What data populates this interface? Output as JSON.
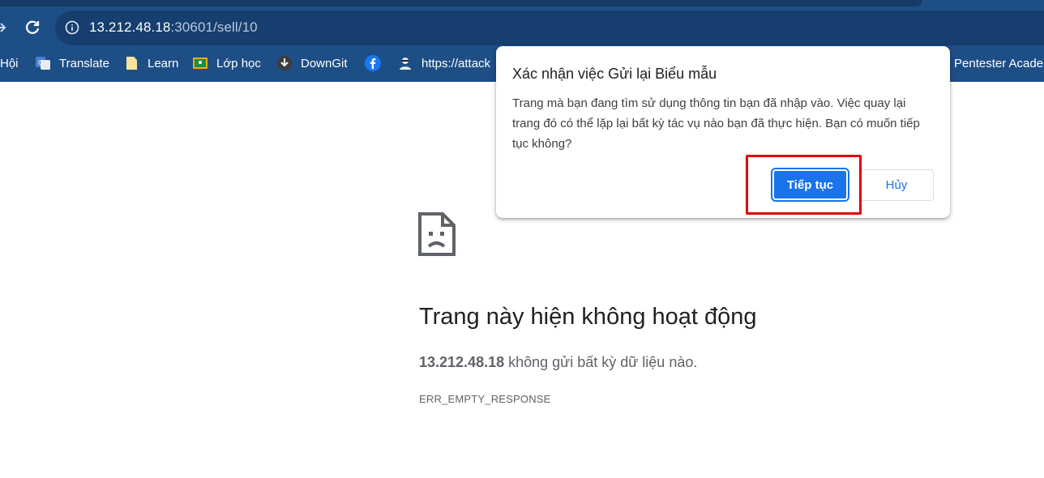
{
  "browser": {
    "url_host": "13.212.48.18",
    "url_path": ":30601/sell/10",
    "bookmarks": [
      {
        "label": "Hội",
        "icon": "folder-icon"
      },
      {
        "label": "Translate",
        "icon": "google-translate-icon"
      },
      {
        "label": "Learn",
        "icon": "folder-icon"
      },
      {
        "label": "Lớp học",
        "icon": "google-classroom-icon"
      },
      {
        "label": "DownGit",
        "icon": "download-icon"
      },
      {
        "label": "",
        "icon": "facebook-icon"
      },
      {
        "label": "https://attack",
        "icon": "hacker-icon"
      },
      {
        "label": "Pentester Acader",
        "icon": "bookmark-icon"
      }
    ]
  },
  "error_page": {
    "title": "Trang này hiện không hoạt động",
    "host": "13.212.48.18",
    "message": " không gửi bất kỳ dữ liệu nào.",
    "code": "ERR_EMPTY_RESPONSE"
  },
  "dialog": {
    "title": "Xác nhận việc Gửi lại Biểu mẫu",
    "body": "Trang mà bạn đang tìm sử dụng thông tin bạn đã nhập vào. Việc quay lại trang đó có thể lặp lại bất kỳ tác vụ nào bạn đã thực hiện. Bạn có muốn tiếp tục không?",
    "continue_label": "Tiếp tục",
    "cancel_label": "Hủy"
  },
  "colors": {
    "chrome": "#1e4e86",
    "primary": "#1a73e8",
    "highlight": "#e00000"
  }
}
